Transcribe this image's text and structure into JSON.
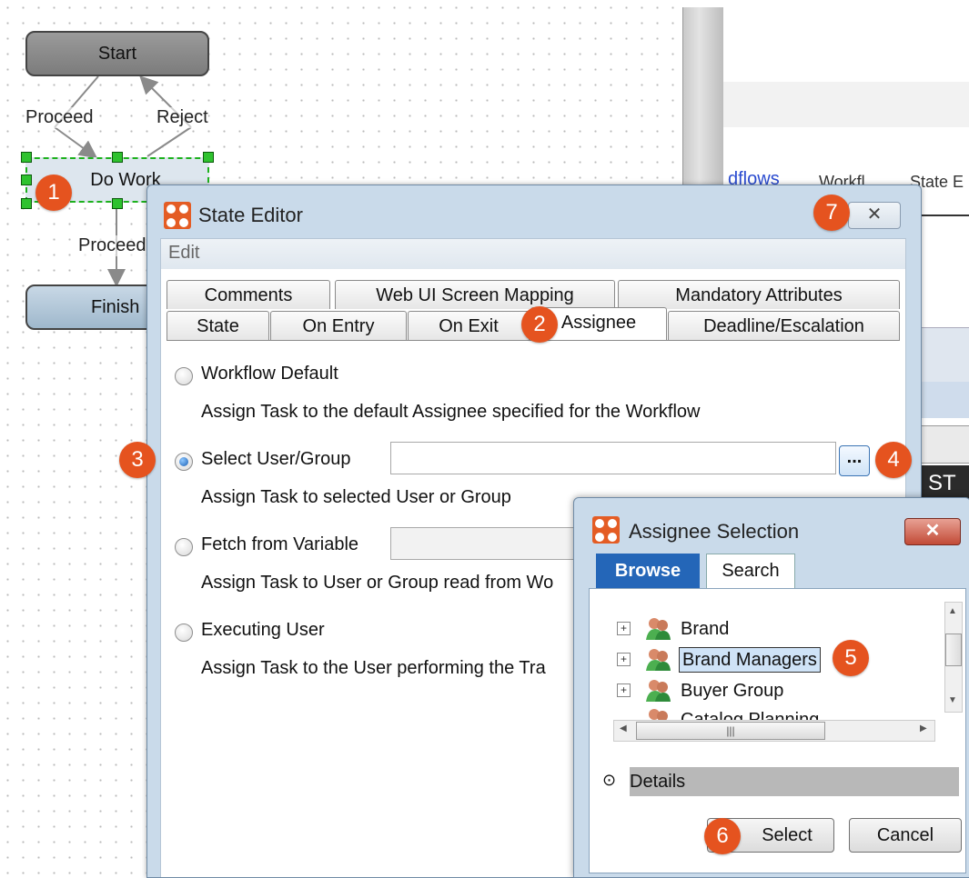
{
  "workflow": {
    "nodes": {
      "start": "Start",
      "do_work": "Do Work",
      "finish": "Finish"
    },
    "edges": {
      "proceed1": "Proceed",
      "reject": "Reject",
      "proceed2": "Proceed"
    }
  },
  "background_panel": {
    "link": "dflows",
    "tab1": "Workfl...",
    "tab2": "State E",
    "code": "ST"
  },
  "state_editor": {
    "title": "State Editor",
    "menu": [
      "Edit"
    ],
    "tabs_row1": [
      "Comments",
      "Web UI Screen Mapping",
      "Mandatory Attributes"
    ],
    "tabs_row2": [
      "State",
      "On Entry",
      "On Exit",
      "Assignee",
      "Deadline/Escalation"
    ],
    "active_tab": "Assignee",
    "options": [
      {
        "label": "Workflow Default",
        "desc": "Assign Task to the default Assignee specified for the Workflow",
        "selected": false
      },
      {
        "label": "Select User/Group",
        "desc": "Assign Task to selected User or Group",
        "selected": true
      },
      {
        "label": "Fetch from Variable",
        "desc": "Assign Task to User or Group read from Wo",
        "selected": false
      },
      {
        "label": "Executing User",
        "desc": "Assign Task to the User performing the Tra",
        "selected": false
      }
    ],
    "browse_button": "...",
    "close_button": "✕"
  },
  "assignee_selection": {
    "title": "Assignee Selection",
    "tabs": [
      "Browse",
      "Search"
    ],
    "tree": [
      {
        "label": "Brand",
        "selected": false
      },
      {
        "label": "Brand Managers",
        "selected": true
      },
      {
        "label": "Buyer Group",
        "selected": false
      },
      {
        "label": "Catalog Planning",
        "selected": false
      }
    ],
    "details": "Details",
    "buttons": {
      "select": "Select",
      "cancel": "Cancel"
    },
    "close_button": "✕"
  },
  "callouts": [
    "1",
    "2",
    "3",
    "4",
    "5",
    "6",
    "7"
  ],
  "colors": {
    "callout": "#e5531f",
    "dialog_frame": "#c9daea",
    "browse_tab": "#2466b8",
    "selection": "#cfe3f7"
  }
}
